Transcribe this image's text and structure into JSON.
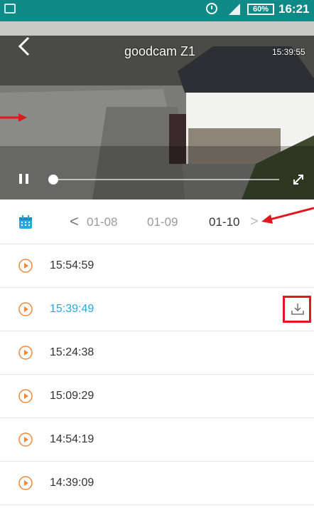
{
  "status_bar": {
    "battery": "60%",
    "time": "16:21"
  },
  "video": {
    "camera_name": "goodcam Z1",
    "timestamp": "15:39:55",
    "progress": 0.02
  },
  "date_bar": {
    "prev_symbol": "<",
    "dates": [
      "01-08",
      "01-09",
      "01-10"
    ],
    "selected_date": "01-10",
    "next_symbol": ">"
  },
  "recordings": [
    {
      "time": "15:54:59"
    },
    {
      "time": "15:39:49",
      "active": true
    },
    {
      "time": "15:24:38"
    },
    {
      "time": "15:09:29"
    },
    {
      "time": "14:54:19"
    },
    {
      "time": "14:39:09"
    }
  ],
  "colors": {
    "accent": "#29a9e0",
    "play": "#f0883a",
    "statusbar": "#0f8a86",
    "highlight": "#e0181f"
  },
  "icons": [
    "back-icon",
    "pause-icon",
    "fullscreen-icon",
    "calendar-icon",
    "play-icon",
    "download-icon"
  ]
}
